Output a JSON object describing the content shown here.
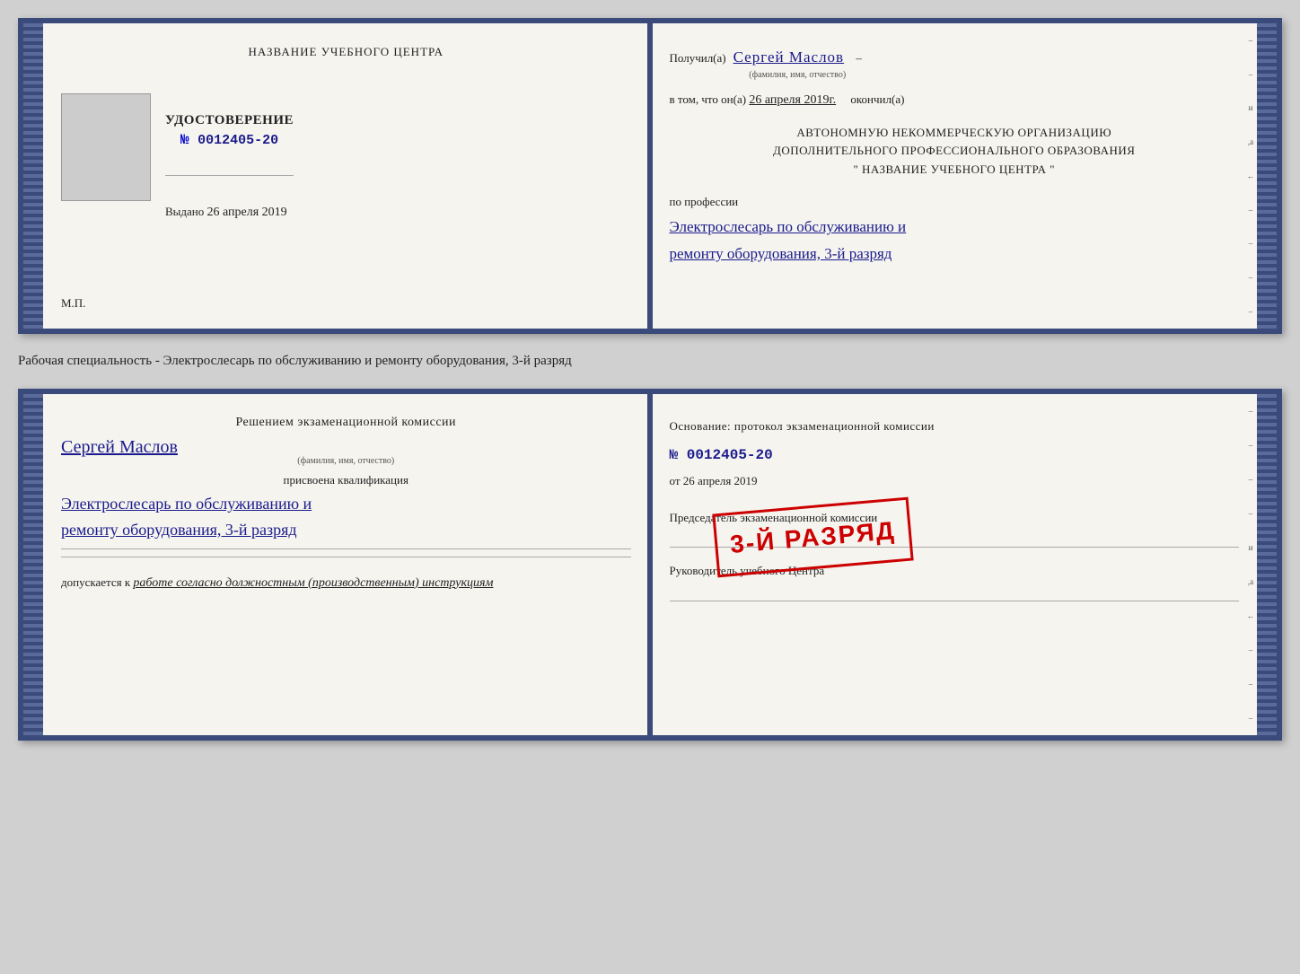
{
  "page": {
    "background": "#d0d0d0"
  },
  "book1": {
    "left": {
      "title": "НАЗВАНИЕ УЧЕБНОГО ЦЕНТРА",
      "doc_title": "УДОСТОВЕРЕНИЕ",
      "doc_number_prefix": "№",
      "doc_number": "0012405-20",
      "issued_label": "Выдано",
      "issued_date": "26 апреля 2019",
      "mp_label": "М.П."
    },
    "right": {
      "received_label": "Получил(а)",
      "recipient_name": "Сергей Маслов",
      "fio_label": "(фамилия, имя, отчество)",
      "dash": "–",
      "date_line_start": "в том, что он(а)",
      "date_handwritten": "26 апреля 2019г.",
      "finished_label": "окончил(а)",
      "org_line1": "АВТОНОМНУЮ НЕКОММЕРЧЕСКУЮ ОРГАНИЗАЦИЮ",
      "org_line2": "ДОПОЛНИТЕЛЬНОГО ПРОФЕССИОНАЛЬНОГО ОБРАЗОВАНИЯ",
      "org_line3": "\" НАЗВАНИЕ УЧЕБНОГО ЦЕНТРА \"",
      "profession_label": "по профессии",
      "profession_handwritten_line1": "Электрослесарь по обслуживанию и",
      "profession_handwritten_line2": "ремонту оборудования, 3-й разряд"
    }
  },
  "between": {
    "text": "Рабочая специальность - Электрослесарь по обслуживанию и ремонту оборудования, 3-й разряд"
  },
  "book2": {
    "left": {
      "commission_title": "Решением экзаменационной комиссии",
      "commission_name": "Сергей Маслов",
      "fio_label": "(фамилия, имя, отчество)",
      "assigned_label": "присвоена квалификация",
      "profession_line1": "Электрослесарь по обслуживанию и",
      "profession_line2": "ремонту оборудования, 3-й разряд",
      "allowed_label": "допускается к",
      "allowed_handwritten": "работе согласно должностным (производственным) инструкциям",
      "stamp_text": "3-й разряд"
    },
    "right": {
      "basis_label": "Основание: протокол экзаменационной комиссии",
      "number_prefix": "№",
      "number": "0012405-20",
      "date_prefix": "от",
      "date": "26 апреля 2019",
      "chairman_label": "Председатель экзаменационной комиссии",
      "director_label": "Руководитель учебного Центра"
    }
  }
}
